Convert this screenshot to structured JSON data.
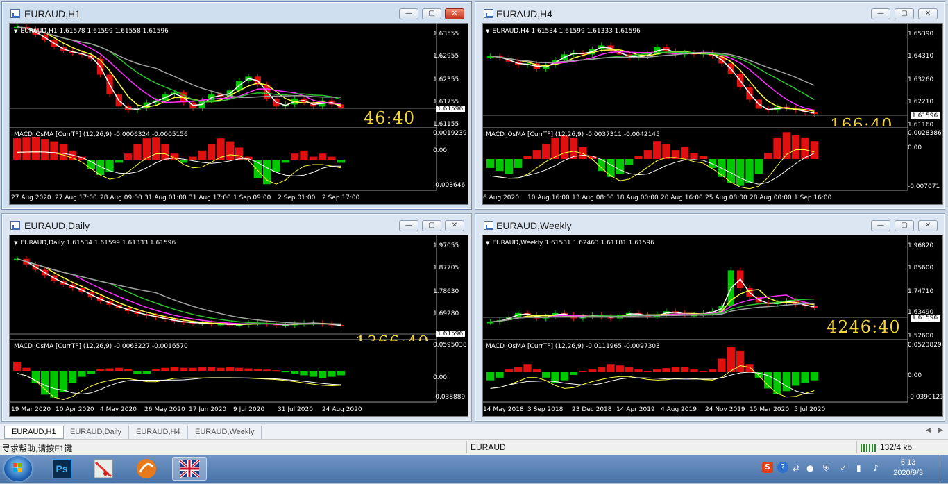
{
  "windows": [
    {
      "title": "EURAUD,H1",
      "legend": "EURAUD,H1  1.61578 1.61599 1.61558 1.61596",
      "prices": [
        "1.63555",
        "1.62955",
        "1.62355",
        "1.61755",
        "1.61155"
      ],
      "current_price": "1.61596",
      "macd_legend": "MACD_OsMA [CurrTF] (12,26,9) -0.0006324 -0.0005156",
      "macd_scale": [
        "0.0019239",
        "0.00",
        "-0.003646"
      ],
      "timer": "46:40",
      "dates": [
        "27 Aug 2020",
        "27 Aug 17:00",
        "28 Aug 09:00",
        "31 Aug 01:00",
        "31 Aug 17:00",
        "1 Sep 09:00",
        "2 Sep 01:00",
        "2 Sep 17:00"
      ]
    },
    {
      "title": "EURAUD,H4",
      "legend": "EURAUD,H4  1.61534 1.61599 1.61333 1.61596",
      "prices": [
        "1.65390",
        "1.64310",
        "1.63260",
        "1.62210",
        "1.61160"
      ],
      "current_price": "1.61596",
      "macd_legend": "MACD_OsMA [CurrTF] (12,26,9) -0.0037311 -0.0042145",
      "macd_scale": [
        "0.0028386",
        "0.00",
        "-0.007071"
      ],
      "timer": "166:40",
      "dates": [
        "6 Aug 2020",
        "10 Aug 16:00",
        "13 Aug 08:00",
        "18 Aug 00:00",
        "20 Aug 16:00",
        "25 Aug 08:00",
        "28 Aug 00:00",
        "1 Sep 16:00"
      ]
    },
    {
      "title": "EURAUD,Daily",
      "legend": "EURAUD,Daily  1.61534 1.61599 1.61333 1.61596",
      "prices": [
        "1.97055",
        "1.87705",
        "1.78630",
        "1.69280"
      ],
      "current_price": "1.61596",
      "macd_legend": "MACD_OsMA [CurrTF] (12,26,9) -0.0063227 -0.0016570",
      "macd_scale": [
        "0.0595038",
        "0.00",
        "-0.038889"
      ],
      "timer": "1366:40",
      "dates": [
        "19 Mar 2020",
        "10 Apr 2020",
        "4 May 2020",
        "26 May 2020",
        "17 Jun 2020",
        "9 Jul 2020",
        "31 Jul 2020",
        "24 Aug 2020"
      ]
    },
    {
      "title": "EURAUD,Weekly",
      "legend": "EURAUD,Weekly  1.61531 1.62463 1.61181 1.61596",
      "prices": [
        "1.96820",
        "1.85600",
        "1.74710",
        "1.63490",
        "1.52600"
      ],
      "current_price": "1.61596",
      "macd_legend": "MACD_OsMA [CurrTF] (12,26,9) -0.0111965 -0.0097303",
      "macd_scale": [
        "0.0523829",
        "0.00",
        "-0.0390121"
      ],
      "timer": "4246:40",
      "dates": [
        "14 May 2018",
        "3 Sep 2018",
        "23 Dec 2018",
        "14 Apr 2019",
        "4 Aug 2019",
        "24 Nov 2019",
        "15 Mar 2020",
        "5 Jul 2020"
      ]
    }
  ],
  "window_buttons": {
    "minimize": "—",
    "maximize": "▢",
    "close": "✕"
  },
  "tabs": [
    "EURAUD,H1",
    "EURAUD,Daily",
    "EURAUD,H4",
    "EURAUD,Weekly"
  ],
  "tab_nav": {
    "left": "◀",
    "right": "▶"
  },
  "status": {
    "help": "寻求帮助,请按F1键",
    "symbol": "EURAUD",
    "traffic": "132/4 kb"
  },
  "taskbar": {
    "ps": "Ps",
    "time": "6:13",
    "date": "2020/9/3"
  },
  "colors": {
    "bull": "#00c800",
    "bear": "#e01010",
    "ma_fast": "#ffffff",
    "ma_yellow": "#ffff40",
    "ma_magenta": "#ff30ff",
    "ma_green": "#30c030",
    "ma_grey": "#a0a0a0",
    "timer": "#f3d43c"
  },
  "series": {
    "h1": {
      "price": [
        0.98,
        0.96,
        0.9,
        0.85,
        0.78,
        0.74,
        0.72,
        0.7,
        0.66,
        0.5,
        0.3,
        0.18,
        0.14,
        0.16,
        0.22,
        0.24,
        0.3,
        0.32,
        0.22,
        0.16,
        0.24,
        0.3,
        0.28,
        0.34,
        0.44,
        0.48,
        0.4,
        0.26,
        0.18,
        0.2,
        0.26,
        0.22,
        0.18,
        0.24,
        0.2,
        0.16
      ],
      "macd": [
        0.7,
        0.72,
        0.74,
        0.68,
        0.6,
        0.5,
        0.3,
        0.1,
        -0.3,
        -0.5,
        -0.4,
        -0.1,
        0.2,
        0.5,
        0.7,
        0.72,
        0.5,
        0.2,
        -0.1,
        0.1,
        0.3,
        0.5,
        0.7,
        0.6,
        0.4,
        0.1,
        -0.6,
        -0.8,
        -0.4,
        -0.1,
        0.2,
        0.3,
        0.1,
        0.2,
        0.1,
        -0.1
      ]
    },
    "h4": {
      "price": [
        0.7,
        0.68,
        0.64,
        0.6,
        0.62,
        0.56,
        0.6,
        0.66,
        0.72,
        0.74,
        0.72,
        0.78,
        0.82,
        0.76,
        0.72,
        0.68,
        0.7,
        0.72,
        0.8,
        0.76,
        0.72,
        0.74,
        0.72,
        0.74,
        0.7,
        0.62,
        0.5,
        0.36,
        0.22,
        0.12,
        0.1,
        0.14,
        0.12,
        0.1,
        0.08,
        0.06
      ],
      "macd": [
        -0.3,
        -0.4,
        -0.5,
        -0.3,
        0.1,
        0.3,
        0.5,
        0.7,
        0.8,
        0.7,
        0.4,
        0.1,
        -0.4,
        -0.6,
        -0.5,
        -0.2,
        0.1,
        0.3,
        0.6,
        0.5,
        0.3,
        0.4,
        0.2,
        0.1,
        -0.3,
        -0.6,
        -0.8,
        -0.9,
        -0.8,
        -0.5,
        0.2,
        0.7,
        0.9,
        0.8,
        0.7,
        0.6
      ]
    },
    "daily": {
      "price": [
        0.82,
        0.76,
        0.7,
        0.64,
        0.58,
        0.54,
        0.5,
        0.46,
        0.4,
        0.36,
        0.32,
        0.28,
        0.25,
        0.22,
        0.2,
        0.18,
        0.16,
        0.14,
        0.13,
        0.12,
        0.12,
        0.11,
        0.11,
        0.1,
        0.1,
        0.12,
        0.12,
        0.11,
        0.1,
        0.1,
        0.11,
        0.12,
        0.12,
        0.11,
        0.1,
        0.09
      ],
      "macd": [
        0.3,
        0.1,
        -0.4,
        -0.8,
        -0.9,
        -0.7,
        -0.4,
        -0.2,
        -0.1,
        0.05,
        0.08,
        0.1,
        0.06,
        -0.1,
        -0.1,
        0.05,
        0.1,
        0.12,
        0.1,
        0.1,
        0.12,
        0.14,
        0.1,
        0.12,
        0.1,
        0.08,
        0.06,
        0.04,
        0.02,
        -0.05,
        -0.1,
        -0.15,
        -0.2,
        -0.25,
        -0.2,
        -0.15
      ]
    },
    "weekly": {
      "price": [
        0.12,
        0.14,
        0.18,
        0.22,
        0.2,
        0.16,
        0.18,
        0.22,
        0.2,
        0.16,
        0.18,
        0.2,
        0.18,
        0.16,
        0.2,
        0.22,
        0.2,
        0.18,
        0.2,
        0.24,
        0.22,
        0.2,
        0.2,
        0.22,
        0.24,
        0.3,
        0.7,
        0.5,
        0.4,
        0.34,
        0.32,
        0.34,
        0.36,
        0.32,
        0.3,
        0.28
      ],
      "macd": [
        -0.3,
        -0.2,
        0.1,
        0.2,
        0.3,
        0.1,
        -0.2,
        -0.4,
        -0.3,
        -0.1,
        0.05,
        0.1,
        0.2,
        0.3,
        0.25,
        0.2,
        0.1,
        0.05,
        0.1,
        0.15,
        0.2,
        0.18,
        0.1,
        0.05,
        0.1,
        0.5,
        0.95,
        0.8,
        0.3,
        -0.2,
        -0.6,
        -0.8,
        -0.7,
        -0.5,
        -0.4,
        -0.3
      ]
    }
  }
}
